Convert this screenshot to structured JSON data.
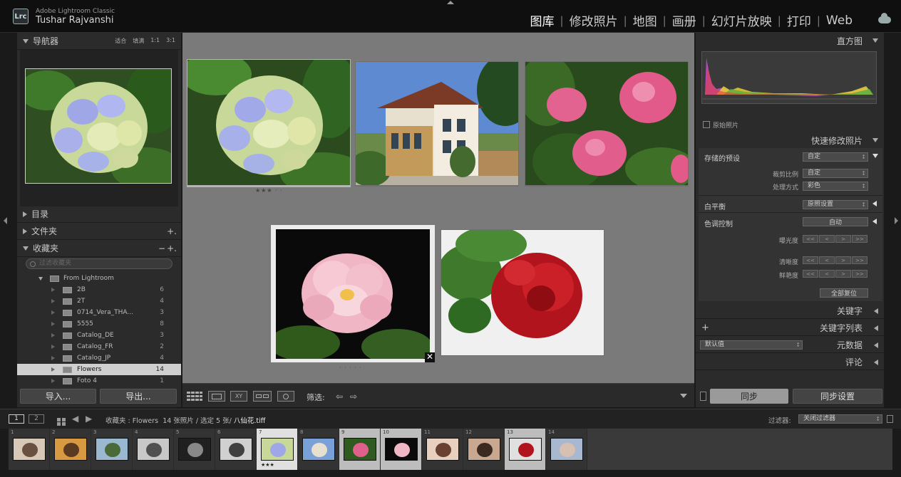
{
  "app": {
    "logo": "Lrc",
    "name": "Adobe Lightroom Classic",
    "user": "Tushar Rajvanshi"
  },
  "modules": [
    {
      "label": "图库",
      "active": true
    },
    {
      "label": "修改照片"
    },
    {
      "label": "地图"
    },
    {
      "label": "画册"
    },
    {
      "label": "幻灯片放映"
    },
    {
      "label": "打印"
    },
    {
      "label": "Web"
    }
  ],
  "left_panel": {
    "navigator": {
      "title": "导航器",
      "options": [
        "适合",
        "填满",
        "1:1",
        "3:1"
      ]
    },
    "catalog": {
      "title": "目录"
    },
    "folders": {
      "title": "文件夹",
      "action": "+."
    },
    "collections": {
      "title": "收藏夹",
      "actions": [
        "−",
        "+."
      ],
      "search_placeholder": "过滤收藏夹",
      "root": "From Lightroom",
      "items": [
        {
          "name": "2B",
          "count": "6"
        },
        {
          "name": "2T",
          "count": "4"
        },
        {
          "name": "0714_Vera_THA...",
          "count": "3"
        },
        {
          "name": "5555",
          "count": "8"
        },
        {
          "name": "Catalog_DE",
          "count": "3"
        },
        {
          "name": "Catalog_FR",
          "count": "2"
        },
        {
          "name": "Catalog_JP",
          "count": "4"
        },
        {
          "name": "Flowers",
          "count": "14",
          "selected": true
        },
        {
          "name": "Foto 4",
          "count": "1"
        }
      ]
    },
    "import_label": "导入...",
    "export_label": "导出..."
  },
  "grid": {
    "cells": [
      {
        "name": "hydrangea",
        "stars": "★★★ · ·",
        "selected": true
      },
      {
        "name": "house"
      },
      {
        "name": "pink-hydrangea"
      },
      {
        "name": "peony",
        "selected": true,
        "stars": "· · · · ·"
      },
      {
        "name": "rose"
      }
    ]
  },
  "toolbar": {
    "filter_label": "筛选:",
    "view_labels": [
      "XY"
    ]
  },
  "right_panel": {
    "histogram": {
      "title": "直方图",
      "original_photo": "原始照片"
    },
    "quick_develop": {
      "title": "快速修改照片",
      "saved_preset_label": "存储的预设",
      "saved_preset_value": "自定",
      "crop_label": "裁剪比例",
      "crop_value": "自定",
      "treatment_label": "处理方式",
      "treatment_value": "彩色",
      "wb_label": "白平衡",
      "wb_value": "原照设置",
      "tone_label": "色调控制",
      "auto_label": "自动",
      "exposure_label": "曝光度",
      "clarity_label": "清晰度",
      "vibrance_label": "鲜艳度",
      "reset_label": "全部复位",
      "step_buttons": [
        "<<",
        "<",
        ">",
        ">>"
      ]
    },
    "keywording": {
      "title": "关键字"
    },
    "keyword_list": {
      "title": "关键字列表",
      "add": "+"
    },
    "metadata": {
      "title": "元数据",
      "preset": "默认值"
    },
    "comments": {
      "title": "评论"
    },
    "sync_label": "同步",
    "sync_settings_label": "同步设置"
  },
  "filmstrip_bar": {
    "pages": [
      "1",
      "2"
    ],
    "source": "收藏夹 : Flowers",
    "count_info": "14 张照片 / 选定 5 张/",
    "current_file": "八仙花.tiff",
    "filter_label": "过滤器:",
    "filter_value": "关闭过滤器"
  },
  "filmstrip": [
    {
      "n": "1"
    },
    {
      "n": "2"
    },
    {
      "n": "3"
    },
    {
      "n": "4"
    },
    {
      "n": "5"
    },
    {
      "n": "6"
    },
    {
      "n": "7",
      "stars": "★★★"
    },
    {
      "n": "8"
    },
    {
      "n": "9"
    },
    {
      "n": "10"
    },
    {
      "n": "11"
    },
    {
      "n": "12"
    },
    {
      "n": "13"
    },
    {
      "n": "14"
    }
  ]
}
